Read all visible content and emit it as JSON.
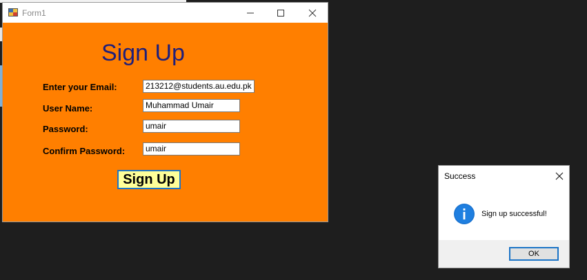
{
  "window": {
    "title": "Form1"
  },
  "form": {
    "heading": "Sign Up",
    "fields": [
      {
        "label": "Enter your Email:",
        "value": "213212@students.au.edu.pk"
      },
      {
        "label": "User Name:",
        "value": "Muhammad Umair"
      },
      {
        "label": "Password:",
        "value": "umair"
      },
      {
        "label": "Confirm Password:",
        "value": "umair"
      }
    ],
    "submit_label": "Sign Up",
    "background_color": "#ff7f00",
    "heading_color": "#1f1f7a",
    "button_color": "#ffff99"
  },
  "message_box": {
    "title": "Success",
    "message": "Sign up successful!",
    "icon": "info-icon",
    "ok_label": "OK"
  }
}
